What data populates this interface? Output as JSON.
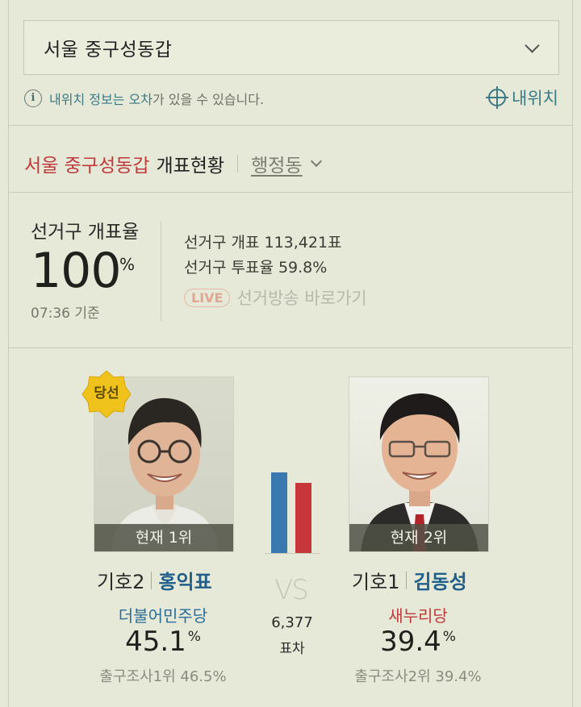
{
  "region_select": {
    "value": "서울 중구성동갑"
  },
  "notice": {
    "part1": "내위치 정보는 오차",
    "part2": "가 있을 수 있습니다.",
    "my_location": "내위치"
  },
  "count_header": {
    "district": "서울 중구성동갑",
    "title": "개표현황",
    "admin_dong": "행정동"
  },
  "count_rate": {
    "label": "선거구 개표율",
    "value": "100",
    "unit": "%",
    "time": "07:36 기준"
  },
  "stats": {
    "counted": "선거구 개표  113,421표",
    "turnout": "선거구 투표율  59.8%",
    "live_badge": "LIVE",
    "live_link": "선거방송 바로가기"
  },
  "winner_badge": "당선",
  "candidates": [
    {
      "rank": "현재 1위",
      "number": "기호2",
      "name": "홍익표",
      "party": "더불어민주당",
      "party_color": "#2a6e99",
      "pct": "45.1",
      "pct_unit": "%",
      "exit_poll": "출구조사1위 46.5%"
    },
    {
      "rank": "현재 2위",
      "number": "기호1",
      "name": "김동성",
      "party": "새누리당",
      "party_color": "#c0393b",
      "pct": "39.4",
      "pct_unit": "%",
      "exit_poll": "출구조사2위 39.4%"
    }
  ],
  "comparison": {
    "vs": "VS",
    "diff": "6,377",
    "diff_label": "표차",
    "values": [
      45.1,
      39.4
    ]
  }
}
